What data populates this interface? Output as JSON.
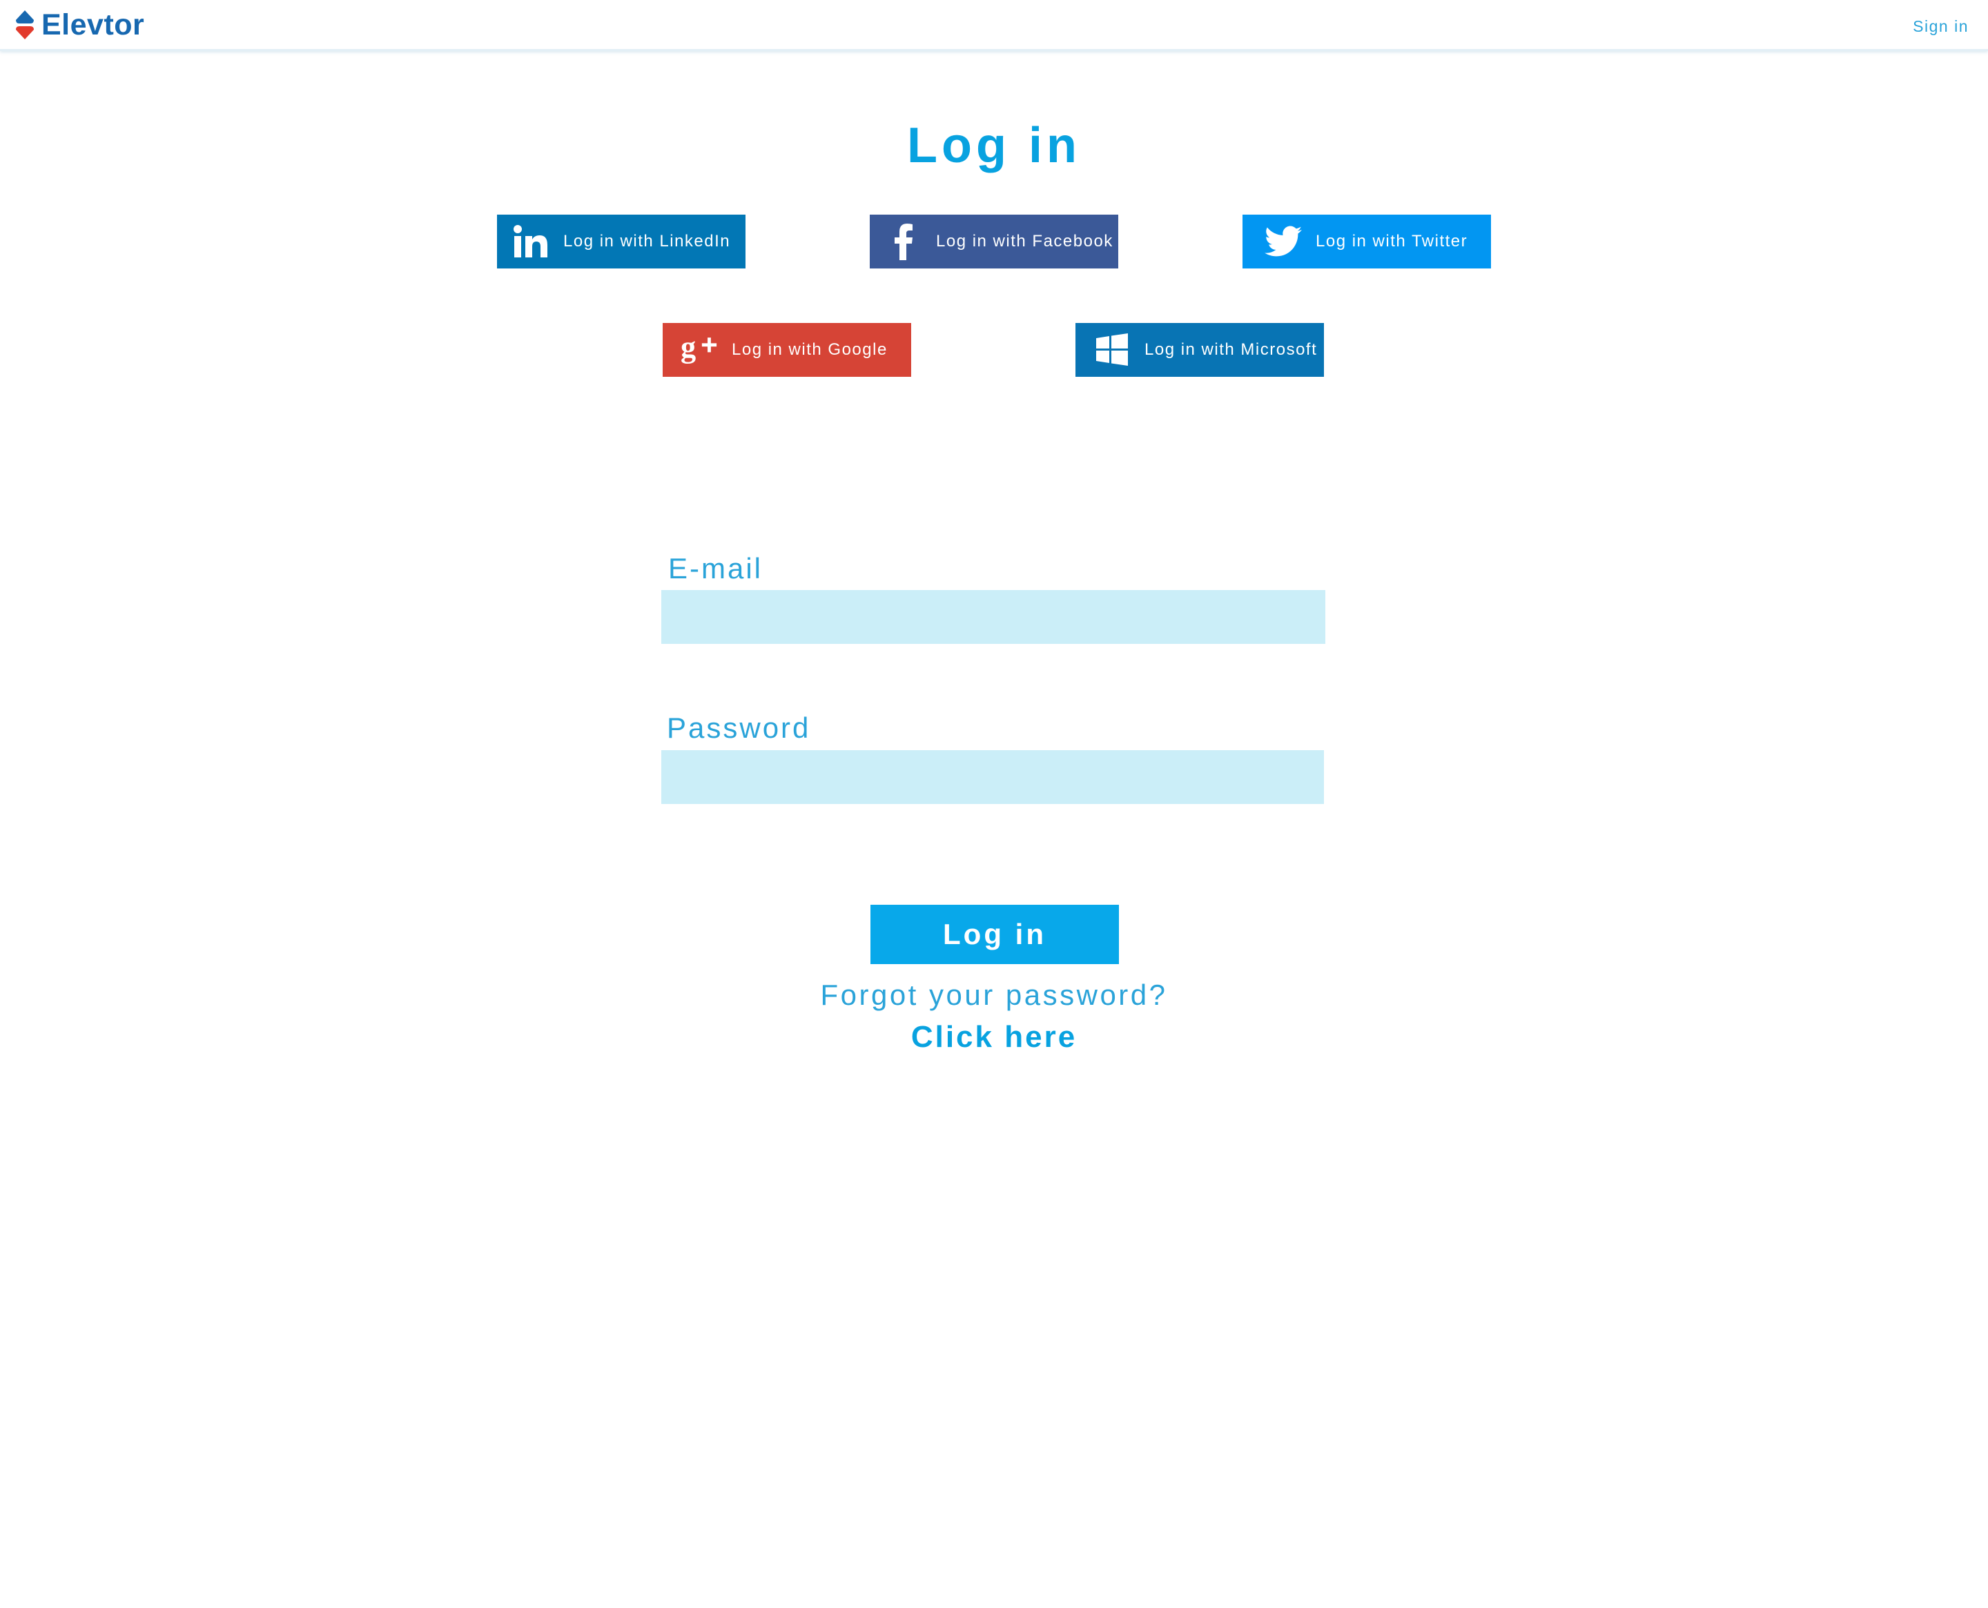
{
  "header": {
    "brand_name": "Elevtor",
    "signin_label": "Sign in"
  },
  "page": {
    "title": "Log in"
  },
  "social": {
    "linkedin": {
      "label": "Log in with LinkedIn",
      "color": "#0277b5",
      "icon": "linkedin-icon"
    },
    "facebook": {
      "label": "Log in with Facebook",
      "color": "#3b5998",
      "icon": "facebook-icon"
    },
    "twitter": {
      "label": "Log in with Twitter",
      "color": "#0296f2",
      "icon": "twitter-icon"
    },
    "google": {
      "label": "Log in with Google",
      "color": "#d64436",
      "icon": "google-plus-icon"
    },
    "microsoft": {
      "label": "Log in with Microsoft",
      "color": "#0874b4",
      "icon": "windows-icon"
    }
  },
  "form": {
    "email_label": "E-mail",
    "email_value": "",
    "password_label": "Password",
    "password_value": "",
    "submit_label": "Log in",
    "forgot_text": "Forgot your password?",
    "forgot_link": "Click here"
  },
  "colors": {
    "accent": "#08a2e0",
    "brand": "#1768b0",
    "input_bg": "#cbeef8"
  }
}
